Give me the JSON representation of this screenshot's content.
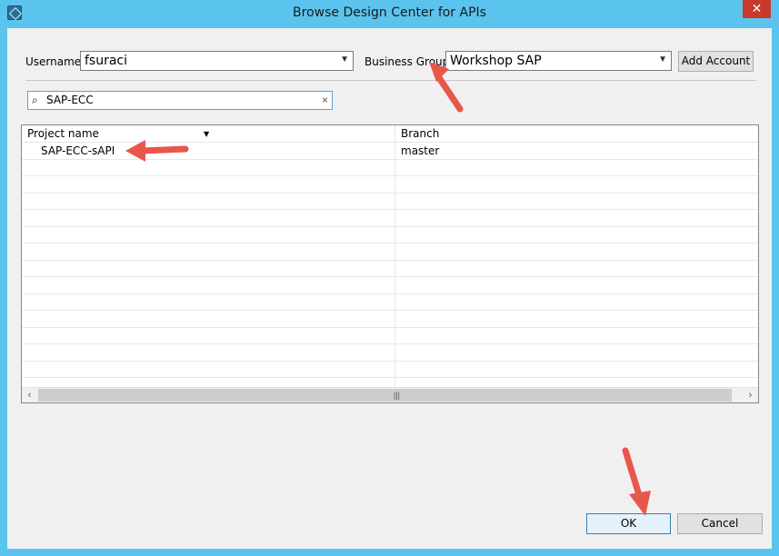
{
  "window": {
    "title": "Browse Design Center for APIs",
    "close_symbol": "✕"
  },
  "form": {
    "username_label": "Username",
    "username_value": "fsuraci",
    "business_group_label": "Business Group",
    "business_group_value": "Workshop SAP",
    "add_account_label": "Add Account"
  },
  "search": {
    "value": "SAP-ECC",
    "clear_symbol": "×",
    "icon": "search-icon"
  },
  "table": {
    "columns": [
      "Project name",
      "Branch"
    ],
    "rows": [
      {
        "project": "SAP-ECC-sAPI",
        "branch": "master"
      },
      {
        "project": "",
        "branch": ""
      },
      {
        "project": "",
        "branch": ""
      },
      {
        "project": "",
        "branch": ""
      },
      {
        "project": "",
        "branch": ""
      },
      {
        "project": "",
        "branch": ""
      },
      {
        "project": "",
        "branch": ""
      },
      {
        "project": "",
        "branch": ""
      },
      {
        "project": "",
        "branch": ""
      },
      {
        "project": "",
        "branch": ""
      },
      {
        "project": "",
        "branch": ""
      },
      {
        "project": "",
        "branch": ""
      },
      {
        "project": "",
        "branch": ""
      },
      {
        "project": "",
        "branch": ""
      },
      {
        "project": "",
        "branch": ""
      }
    ]
  },
  "buttons": {
    "ok_label": "OK",
    "cancel_label": "Cancel"
  },
  "colors": {
    "titlebar": "#5bc4ee",
    "annotation_arrow": "#e8574a"
  }
}
